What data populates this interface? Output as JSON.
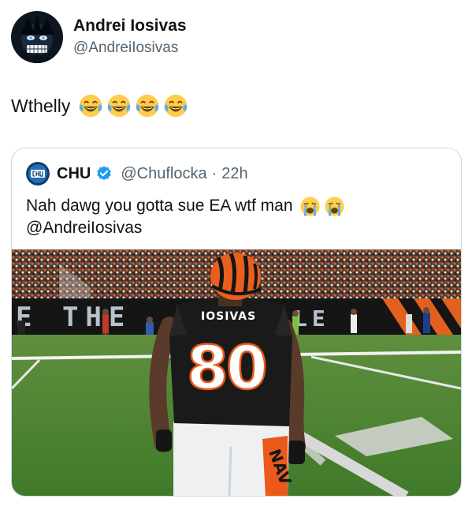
{
  "tweet": {
    "author_name": "Andrei Iosivas",
    "author_handle": "@AndreiIosivas",
    "text": "Wthelly",
    "emojis": [
      "laughing-tears-emoji",
      "laughing-tears-emoji",
      "laughing-tears-emoji",
      "laughing-tears-emoji"
    ]
  },
  "quote": {
    "author_name": "CHU",
    "verified": true,
    "author_handle": "@Chuflocka",
    "separator": "·",
    "time": "22h",
    "text_line1": "Nah dawg you gotta sue EA wtf man",
    "text_line2": "@AndreiIosivas",
    "emojis": [
      "loudly-crying-emoji",
      "loudly-crying-emoji"
    ]
  },
  "media": {
    "jersey_name": "IOSIVAS",
    "jersey_number": "80",
    "banner_text": "E THE",
    "banner_text_right": "LE",
    "pants_text": "NAV"
  },
  "colors": {
    "accent_blue": "#1d9bf0",
    "muted_text": "#536471",
    "border": "#cfd9de",
    "bengals_orange": "#fb4f14",
    "jersey_black": "#1a1a1a"
  }
}
